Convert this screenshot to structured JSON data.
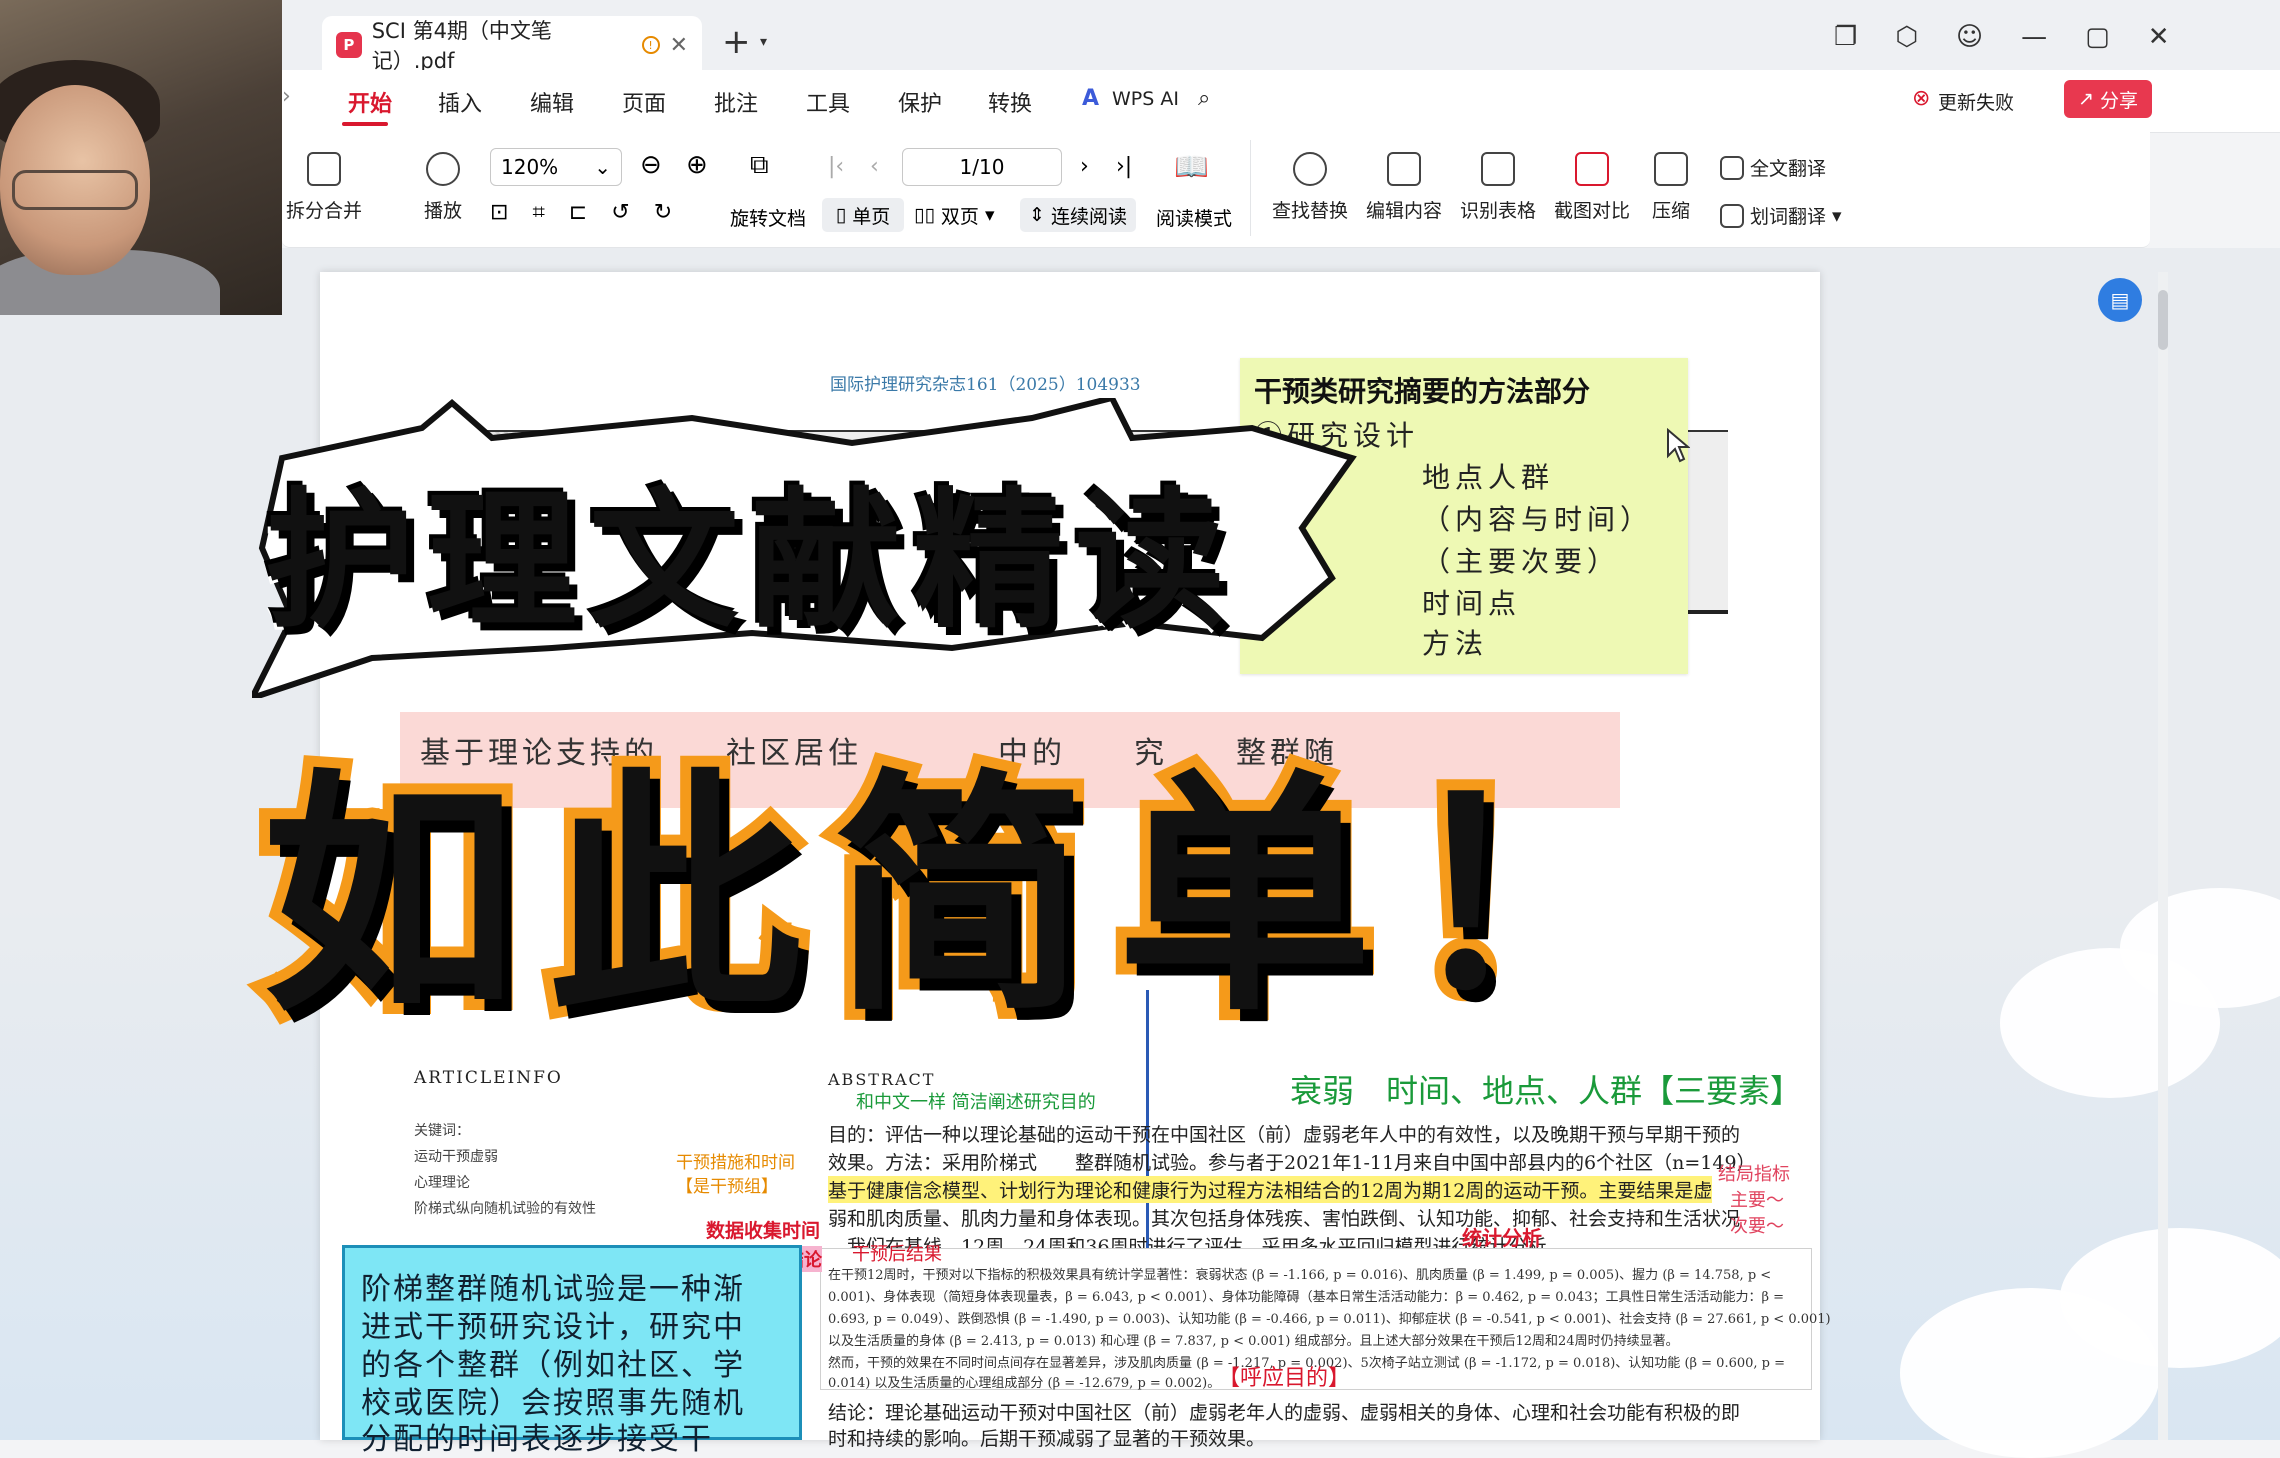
{
  "tab": {
    "filename": "SCI 第4期（中文笔记）.pdf"
  },
  "menu": [
    "开始",
    "插入",
    "编辑",
    "页面",
    "批注",
    "工具",
    "保护",
    "转换"
  ],
  "menu_right": {
    "wps_ai": "WPS AI",
    "update_fail": "更新失败",
    "share": "分享"
  },
  "toolbar": {
    "split_merge": "拆分合并",
    "play": "播放",
    "zoom": "120%",
    "page": "1/10",
    "rotate": "旋转文档",
    "single": "单页",
    "double": "双页",
    "continuous": "连续阅读",
    "read_mode": "阅读模式",
    "find_replace": "查找替换",
    "edit_content": "编辑内容",
    "recognize_table": "识别表格",
    "screenshot_compare": "截图对比",
    "compress": "压缩",
    "full_translate": "全文翻译",
    "word_translate": "划词翻译"
  },
  "doc": {
    "journal": "国际护理研究杂志161（2025）104933",
    "title_fragment": "基于理论支持的　　社区居住　　　　中的　　究　　整群随",
    "article_info": "ARTICLEINFO",
    "keywords_label": "关键词：",
    "keywords": [
      "运动干预虚弱",
      "心理理论",
      "阶梯式纵向随机试验的有效性"
    ],
    "abstract_label": "ABSTRACT",
    "abstract_lines": [
      "目的：评估一种以理论基础的运动干预在中国社区（前）虚弱老年人中的有效性，以及晚期干预与早期干预的",
      "效果。方法：采用阶梯式　　整群随机试验。参与者于2021年1-11月来自中国中部县内的6个社区（n=149）",
      "基于健康信念模型、计划行为理论和健康行为过程方法相结合的12周为期12周的运动干预。主要结果是虚",
      "弱和肌肉质量、肌肉力量和身体表现。其次包括身体残疾、害怕跌倒、认知功能、抑郁、社会支持和生活状况",
      "。我们在基线、12周、24周和36周时进行了评估。采用多水平回归模型进行统计分析。"
    ],
    "result_lines": [
      "在干预12周时，干预对以下指标的积极效果具有统计学显著性：衰弱状态 (β = -1.166, p = 0.016)、肌肉质量 (β = 1.499, p = 0.005)、握力 (β = 14.758, p <",
      "0.001)、身体表现（简短身体表现量表，β = 6.043, p < 0.001）、身体功能障碍（基本日常生活活动能力：β = 0.462, p = 0.043；工具性日常生活活动能力：β =",
      "0.693, p = 0.049）、跌倒恐惧 (β = -1.490, p = 0.003)、认知功能 (β = -0.466, p = 0.011)、抑郁症状 (β = -0.541, p < 0.001)、社会支持 (β = 27.661, p < 0.001)",
      "以及生活质量的身体 (β = 2.413, p = 0.013) 和心理 (β = 7.837, p < 0.001) 组成部分。且上述大部分效果在干预后12周和24周时仍持续显著。",
      "然而，干预的效果在不同时间点间存在显著差异，涉及肌肉质量 (β = -1.217, p = 0.002)、5次椅子站立测试 (β = -1.172, p = 0.018)、认知功能 (β = 0.600, p =",
      "0.014) 以及生活质量的心理组成部分 (β = -12.679, p = 0.002)。"
    ],
    "conclusion_line": "结论：理论基础运动干预对中国社区（前）虚弱老年人的虚弱、虚弱相关的身体、心理和社会功能有积极的即",
    "conclusion_line2": "时和持续的影响。后期干预减弱了显著的干预效果。"
  },
  "sticky_note": {
    "title": "干预类研究摘要的方法部分",
    "lines": [
      "①研究设计",
      "地点人群",
      "（内容与时间）",
      "（主要次要）",
      "时间点",
      "方法"
    ]
  },
  "annotations": {
    "abstract_note": "和中文一样 简洁阐述研究目的",
    "three_elements": "衰弱　时间、地点、人群【三要素】",
    "left_note1": "干预措施和时间",
    "left_note2": "【是干预组】",
    "collect_time": "数据收集时间",
    "result_label": "结论",
    "stats": "统计分析",
    "result_tag": "干预后结果",
    "echo": "【呼应目的】",
    "right_note1": "结局指标",
    "right_note2": "主要～",
    "right_note3": "次要～"
  },
  "cyan_note": {
    "lines": [
      "阶梯整群随机试验是一种渐",
      "进式干预研究设计，研究中",
      "的各个整群（例如社区、学",
      "校或医院）会按照事先随机",
      "分配的时间表逐步接受干"
    ]
  },
  "overlay": {
    "line1": "护理文献精读",
    "line2": "如此简单！"
  },
  "colors": {
    "accent_red": "#d9182e",
    "overlay_orange": "#f59a1a",
    "sticky_green": "#eef9b4",
    "cyan_note": "#7ee6f5",
    "title_pink": "#fbd9d6"
  }
}
